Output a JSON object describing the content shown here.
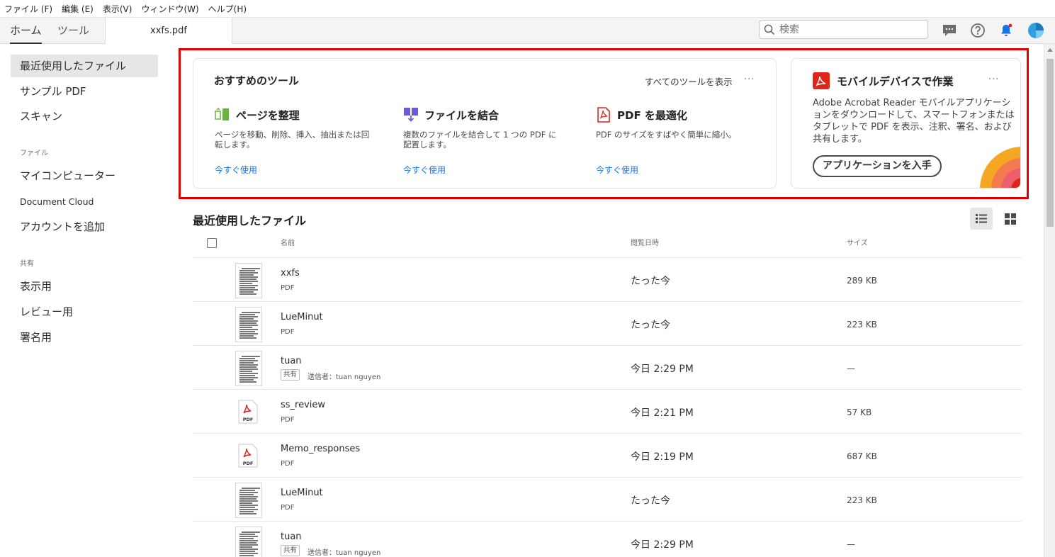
{
  "menu": [
    "ファイル (F)",
    "編集 (E)",
    "表示(V)",
    "ウィンドウ(W)",
    "ヘルプ(H)"
  ],
  "tabs": {
    "home": "ホーム",
    "tools": "ツール",
    "document": "xxfs.pdf"
  },
  "search": {
    "placeholder": "検索"
  },
  "header_icons": [
    "chat-icon",
    "help-icon",
    "bell-icon",
    "avatar"
  ],
  "sidebar": {
    "items_recent": [
      {
        "label": "最近使用したファイル",
        "active": true
      },
      {
        "label": "サンプル PDF"
      },
      {
        "label": "スキャン"
      }
    ],
    "section_files": "ファイル",
    "items_files": [
      {
        "label": "マイコンピューター"
      },
      {
        "label": "Document Cloud"
      },
      {
        "label": "アカウントを追加"
      }
    ],
    "section_shared": "共有",
    "items_shared": [
      {
        "label": "表示用"
      },
      {
        "label": "レビュー用"
      },
      {
        "label": "署名用"
      }
    ]
  },
  "tools_card": {
    "title": "おすすめのツール",
    "show_all": "すべてのツールを表示",
    "more": "···",
    "tools": [
      {
        "name": "ページを整理",
        "desc": "ページを移動、削除、挿入、抽出または回転します。",
        "link": "今すぐ使用",
        "icon": "organize-pages-icon"
      },
      {
        "name": "ファイルを結合",
        "desc": "複数のファイルを結合して 1 つの PDF に配置します。",
        "link": "今すぐ使用",
        "icon": "combine-files-icon"
      },
      {
        "name": "PDF を最適化",
        "desc": "PDF のサイズをすばやく簡単に縮小。",
        "link": "今すぐ使用",
        "icon": "optimize-pdf-icon"
      }
    ]
  },
  "mobile_card": {
    "title": "モバイルデバイスで作業",
    "more": "···",
    "desc": "Adobe Acrobat Reader モバイルアプリケーションをダウンロードして、スマートフォンまたはタブレットで PDF を表示、注釈、署名、および共有します。",
    "button": "アプリケーションを入手",
    "accent": "#e1251b"
  },
  "recent": {
    "title": "最近使用したファイル",
    "columns": {
      "name": "名前",
      "opened": "閲覧日時",
      "size": "サイズ"
    },
    "files": [
      {
        "name": "xxfs",
        "type": "PDF",
        "date": "たった今",
        "size": "289 KB",
        "thumb": "doc"
      },
      {
        "name": "LueMinut",
        "type": "PDF",
        "date": "たった今",
        "size": "223 KB",
        "thumb": "doc"
      },
      {
        "name": "tuan",
        "badge": "共有",
        "sender": "送信者：tuan nguyen",
        "date": "今日 2:29 PM",
        "size": "—",
        "thumb": "doc"
      },
      {
        "name": "ss_review",
        "type": "PDF",
        "date": "今日 2:21 PM",
        "size": "57 KB",
        "thumb": "pdf"
      },
      {
        "name": "Memo_responses",
        "type": "PDF",
        "date": "今日 2:19 PM",
        "size": "687 KB",
        "thumb": "pdf"
      },
      {
        "name": "LueMinut",
        "type": "PDF",
        "date": "たった今",
        "size": "223 KB",
        "thumb": "doc"
      },
      {
        "name": "tuan",
        "badge": "共有",
        "sender": "送信者：tuan nguyen",
        "date": "今日 2:29 PM",
        "size": "—",
        "thumb": "doc"
      }
    ]
  },
  "colors": {
    "highlight_box": "#e00000",
    "link": "#1473e6",
    "acrobat_red": "#e1251b"
  }
}
